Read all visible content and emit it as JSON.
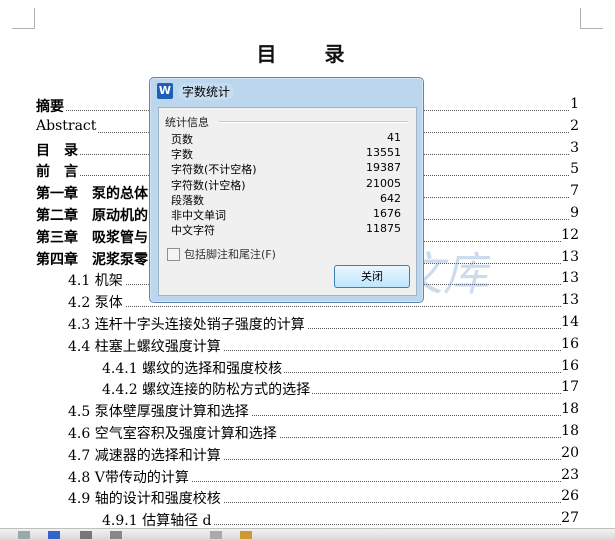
{
  "document": {
    "title": "目　录",
    "toc": [
      {
        "label": "摘要",
        "page": "1",
        "indent": 0,
        "bold": true
      },
      {
        "label": "Abstract",
        "page": "2",
        "indent": 0,
        "bold": false
      },
      {
        "label": "目　录",
        "page": "3",
        "indent": 0,
        "bold": true
      },
      {
        "label": "前　言",
        "page": "5",
        "indent": 0,
        "bold": true
      },
      {
        "label": "第一章　泵的总体",
        "page": "7",
        "indent": 0,
        "bold": true
      },
      {
        "label": "第二章　原动机的",
        "page": "9",
        "indent": 0,
        "bold": true
      },
      {
        "label": "第三章　吸浆管与",
        "page": "12",
        "indent": 0,
        "bold": true
      },
      {
        "label": "第四章　泥浆泵零",
        "page": "13",
        "indent": 0,
        "bold": true
      },
      {
        "label": "4.1  机架",
        "page": "13",
        "indent": 1,
        "bold": false
      },
      {
        "label": "4.2  泵体",
        "page": "13",
        "indent": 1,
        "bold": false
      },
      {
        "label": "4.3  连杆十字头连接处销子强度的计算",
        "page": "14",
        "indent": 1,
        "bold": false
      },
      {
        "label": "4.4  柱塞上螺纹强度计算",
        "page": "16",
        "indent": 1,
        "bold": false
      },
      {
        "label": "4.4.1  螺纹的选择和强度校核",
        "page": "16",
        "indent": 2,
        "bold": false
      },
      {
        "label": "4.4.2  螺纹连接的防松方式的选择",
        "page": "17",
        "indent": 2,
        "bold": false
      },
      {
        "label": "4.5 泵体壁厚强度计算和选择",
        "page": "18",
        "indent": 1,
        "bold": false
      },
      {
        "label": "4.6  空气室容积及强度计算和选择",
        "page": "18",
        "indent": 1,
        "bold": false
      },
      {
        "label": "4.7  减速器的选择和计算",
        "page": "20",
        "indent": 1,
        "bold": false
      },
      {
        "label": "4.8   V带传动的计算",
        "page": "23",
        "indent": 1,
        "bold": false
      },
      {
        "label": "4.9  轴的设计和强度校核",
        "page": "26",
        "indent": 1,
        "bold": false
      },
      {
        "label": "4.9.1  估算轴径 d",
        "page": "27",
        "indent": 2,
        "bold": false
      }
    ]
  },
  "dialog": {
    "title": "字数统计",
    "app_icon_letter": "W",
    "group_label": "统计信息",
    "stats": [
      {
        "key": "页数",
        "value": "41"
      },
      {
        "key": "字数",
        "value": "13551"
      },
      {
        "key": "字符数(不计空格)",
        "value": "19387"
      },
      {
        "key": "字符数(计空格)",
        "value": "21005"
      },
      {
        "key": "段落数",
        "value": "642"
      },
      {
        "key": "非中文单词",
        "value": "1676"
      },
      {
        "key": "中文字符",
        "value": "11875"
      }
    ],
    "checkbox_label": "包括脚注和尾注(F)",
    "checkbox_checked": false,
    "close_label": "关闭"
  },
  "watermark": {
    "brand_text": "人人文库",
    "color": "#5b8fc7"
  }
}
